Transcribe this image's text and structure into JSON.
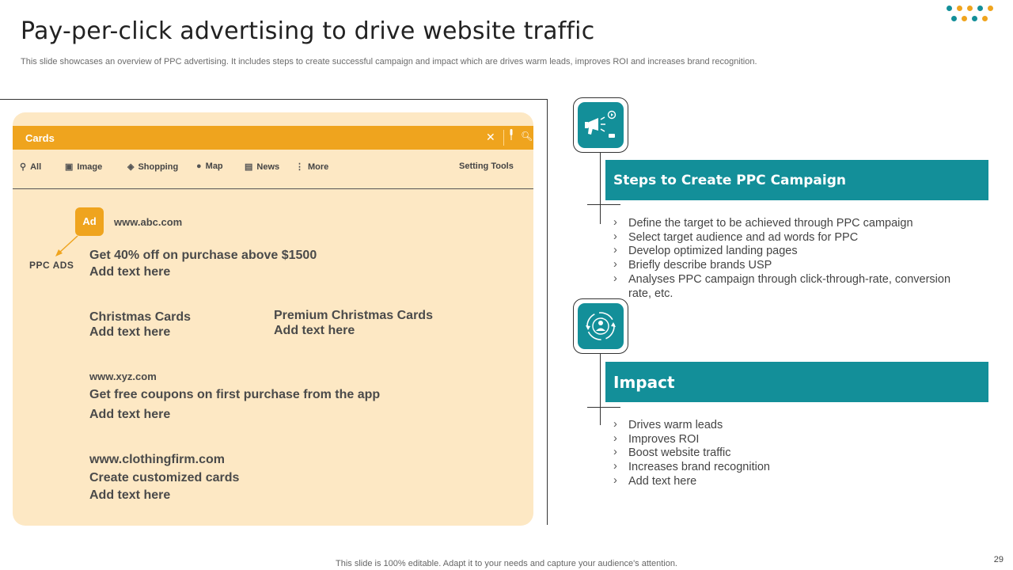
{
  "slide": {
    "title": "Pay-per-click advertising to drive website traffic",
    "subtitle": "This slide showcases an overview of PPC advertising. It includes steps to create successful campaign and impact which are drives warm leads, improves ROI and increases brand recognition.",
    "footer": "This slide is 100% editable. Adapt it to your needs and capture your audience's attention.",
    "page_number": "29"
  },
  "colors": {
    "accent_orange": "#efa41e",
    "accent_teal": "#138f99",
    "panel_bg": "#fde8c4"
  },
  "browser": {
    "tab_title": "Cards",
    "close_icon": "close-icon",
    "nav": [
      {
        "label": "All",
        "icon": "search-icon"
      },
      {
        "label": "Image",
        "icon": "image-icon"
      },
      {
        "label": "Shopping",
        "icon": "tag-icon"
      },
      {
        "label": "Map",
        "icon": "map-pin-icon"
      },
      {
        "label": "News",
        "icon": "news-icon"
      },
      {
        "label": "More",
        "icon": "more-icon"
      }
    ],
    "setting_tools": "Setting Tools",
    "ad_badge": "Ad",
    "ppc_label": "PPC ADS",
    "results": {
      "r1_url": "www.abc.com",
      "r1_line1": "Get 40% off on purchase above $1500",
      "r1_line2": "Add text here",
      "r2a_title": "Christmas Cards",
      "r2a_text": "Add text here",
      "r2b_title": "Premium Christmas Cards",
      "r2b_text": "Add text here",
      "r3_url": "www.xyz.com",
      "r3_line1": "Get free coupons on first purchase from the app",
      "r3_line2": "Add text here",
      "r4_url": "www.clothingfirm.com",
      "r4_line1": "Create customized cards",
      "r4_line2": "Add text here"
    }
  },
  "steps": {
    "heading": "Steps to Create PPC Campaign",
    "icon": "megaphone-icon",
    "items": [
      "Define the target to be achieved through PPC campaign",
      "Select target audience and ad words for PPC",
      "Develop optimized landing pages",
      "Briefly describe brands USP",
      "Analyses PPC campaign through click-through-rate, conversion rate, etc."
    ]
  },
  "impact": {
    "heading": "Impact",
    "icon": "growth-cycle-icon",
    "items": [
      "Drives warm leads",
      "Improves ROI",
      "Boost website traffic",
      "Increases brand recognition",
      "Add text here"
    ]
  }
}
